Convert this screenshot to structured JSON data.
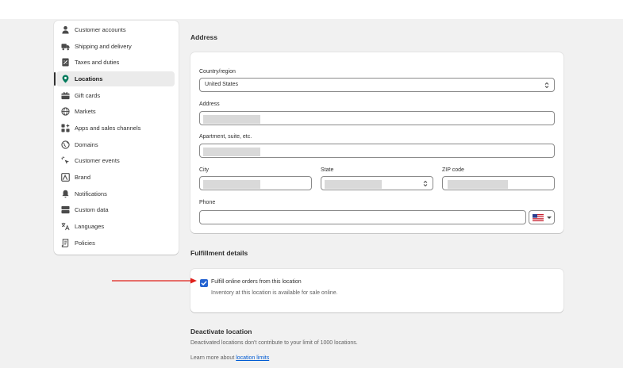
{
  "sidebar": {
    "items": [
      {
        "label": "Customer accounts",
        "icon": "person-icon"
      },
      {
        "label": "Shipping and delivery",
        "icon": "truck-icon"
      },
      {
        "label": "Taxes and duties",
        "icon": "receipt-icon"
      },
      {
        "label": "Locations",
        "icon": "location-pin-icon",
        "active": true
      },
      {
        "label": "Gift cards",
        "icon": "gift-card-icon"
      },
      {
        "label": "Markets",
        "icon": "globe-icon"
      },
      {
        "label": "Apps and sales channels",
        "icon": "apps-icon"
      },
      {
        "label": "Domains",
        "icon": "domain-globe-icon"
      },
      {
        "label": "Customer events",
        "icon": "sparkle-cursor-icon"
      },
      {
        "label": "Brand",
        "icon": "brand-icon"
      },
      {
        "label": "Notifications",
        "icon": "bell-icon"
      },
      {
        "label": "Custom data",
        "icon": "database-icon"
      },
      {
        "label": "Languages",
        "icon": "translate-icon"
      },
      {
        "label": "Policies",
        "icon": "policy-document-icon"
      }
    ]
  },
  "address": {
    "title": "Address",
    "country_label": "Country/region",
    "country_value": "United States",
    "address_label": "Address",
    "apartment_label": "Apartment, suite, etc.",
    "city_label": "City",
    "state_label": "State",
    "zip_label": "ZIP code",
    "phone_label": "Phone",
    "phone_flag": "us-flag-icon"
  },
  "fulfillment": {
    "title": "Fulfillment details",
    "checkbox_label": "Fulfill online orders from this location",
    "checkbox_checked": true,
    "help_text": "Inventory at this location is available for sale online."
  },
  "deactivate": {
    "title": "Deactivate location",
    "description": "Deactivated locations don't contribute to your limit of 1000 locations.",
    "learn_prefix": "Learn more about ",
    "learn_link": "location limits"
  },
  "colors": {
    "accent": "#2463d1",
    "link": "#005bd3",
    "annotation_arrow": "#e0201b"
  }
}
